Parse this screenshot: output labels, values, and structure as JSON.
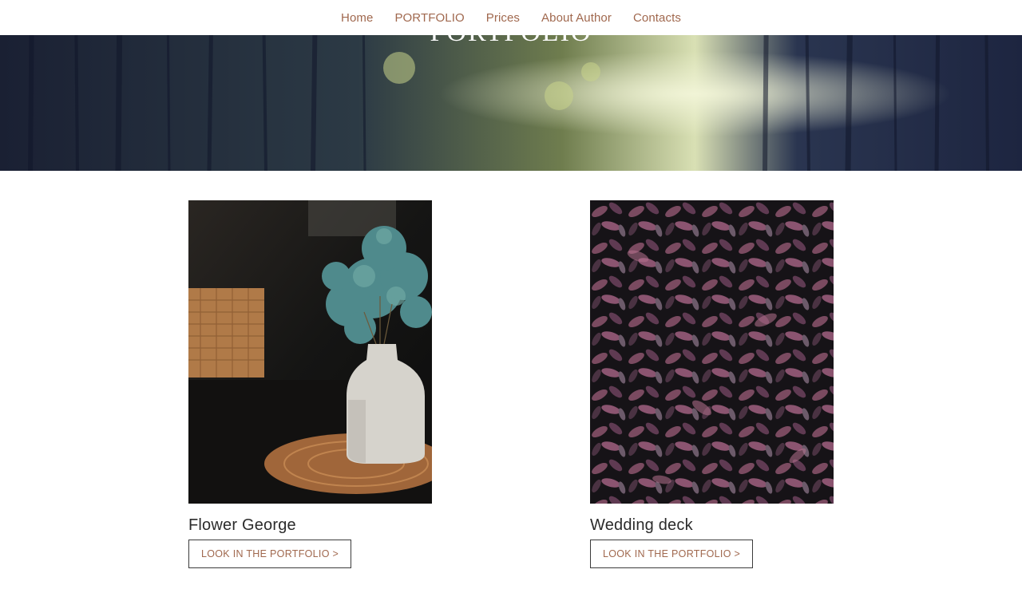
{
  "nav": {
    "items": [
      {
        "label": "Home"
      },
      {
        "label": "PORTFOLIO"
      },
      {
        "label": "Prices"
      },
      {
        "label": "About Author"
      },
      {
        "label": "Contacts"
      }
    ],
    "link_color": "#a0684e"
  },
  "hero": {
    "title": "PORTFOLIO",
    "image": "forest-sunlight-photo"
  },
  "cards": [
    {
      "title": "Flower George",
      "image": "vase-with-dried-flowers-photo",
      "button_label": "LOOK IN THE PORTFOLIO >"
    },
    {
      "title": "Wedding deck",
      "image": "purple-leaves-photo",
      "button_label": "LOOK IN THE PORTFOLIO >"
    }
  ]
}
